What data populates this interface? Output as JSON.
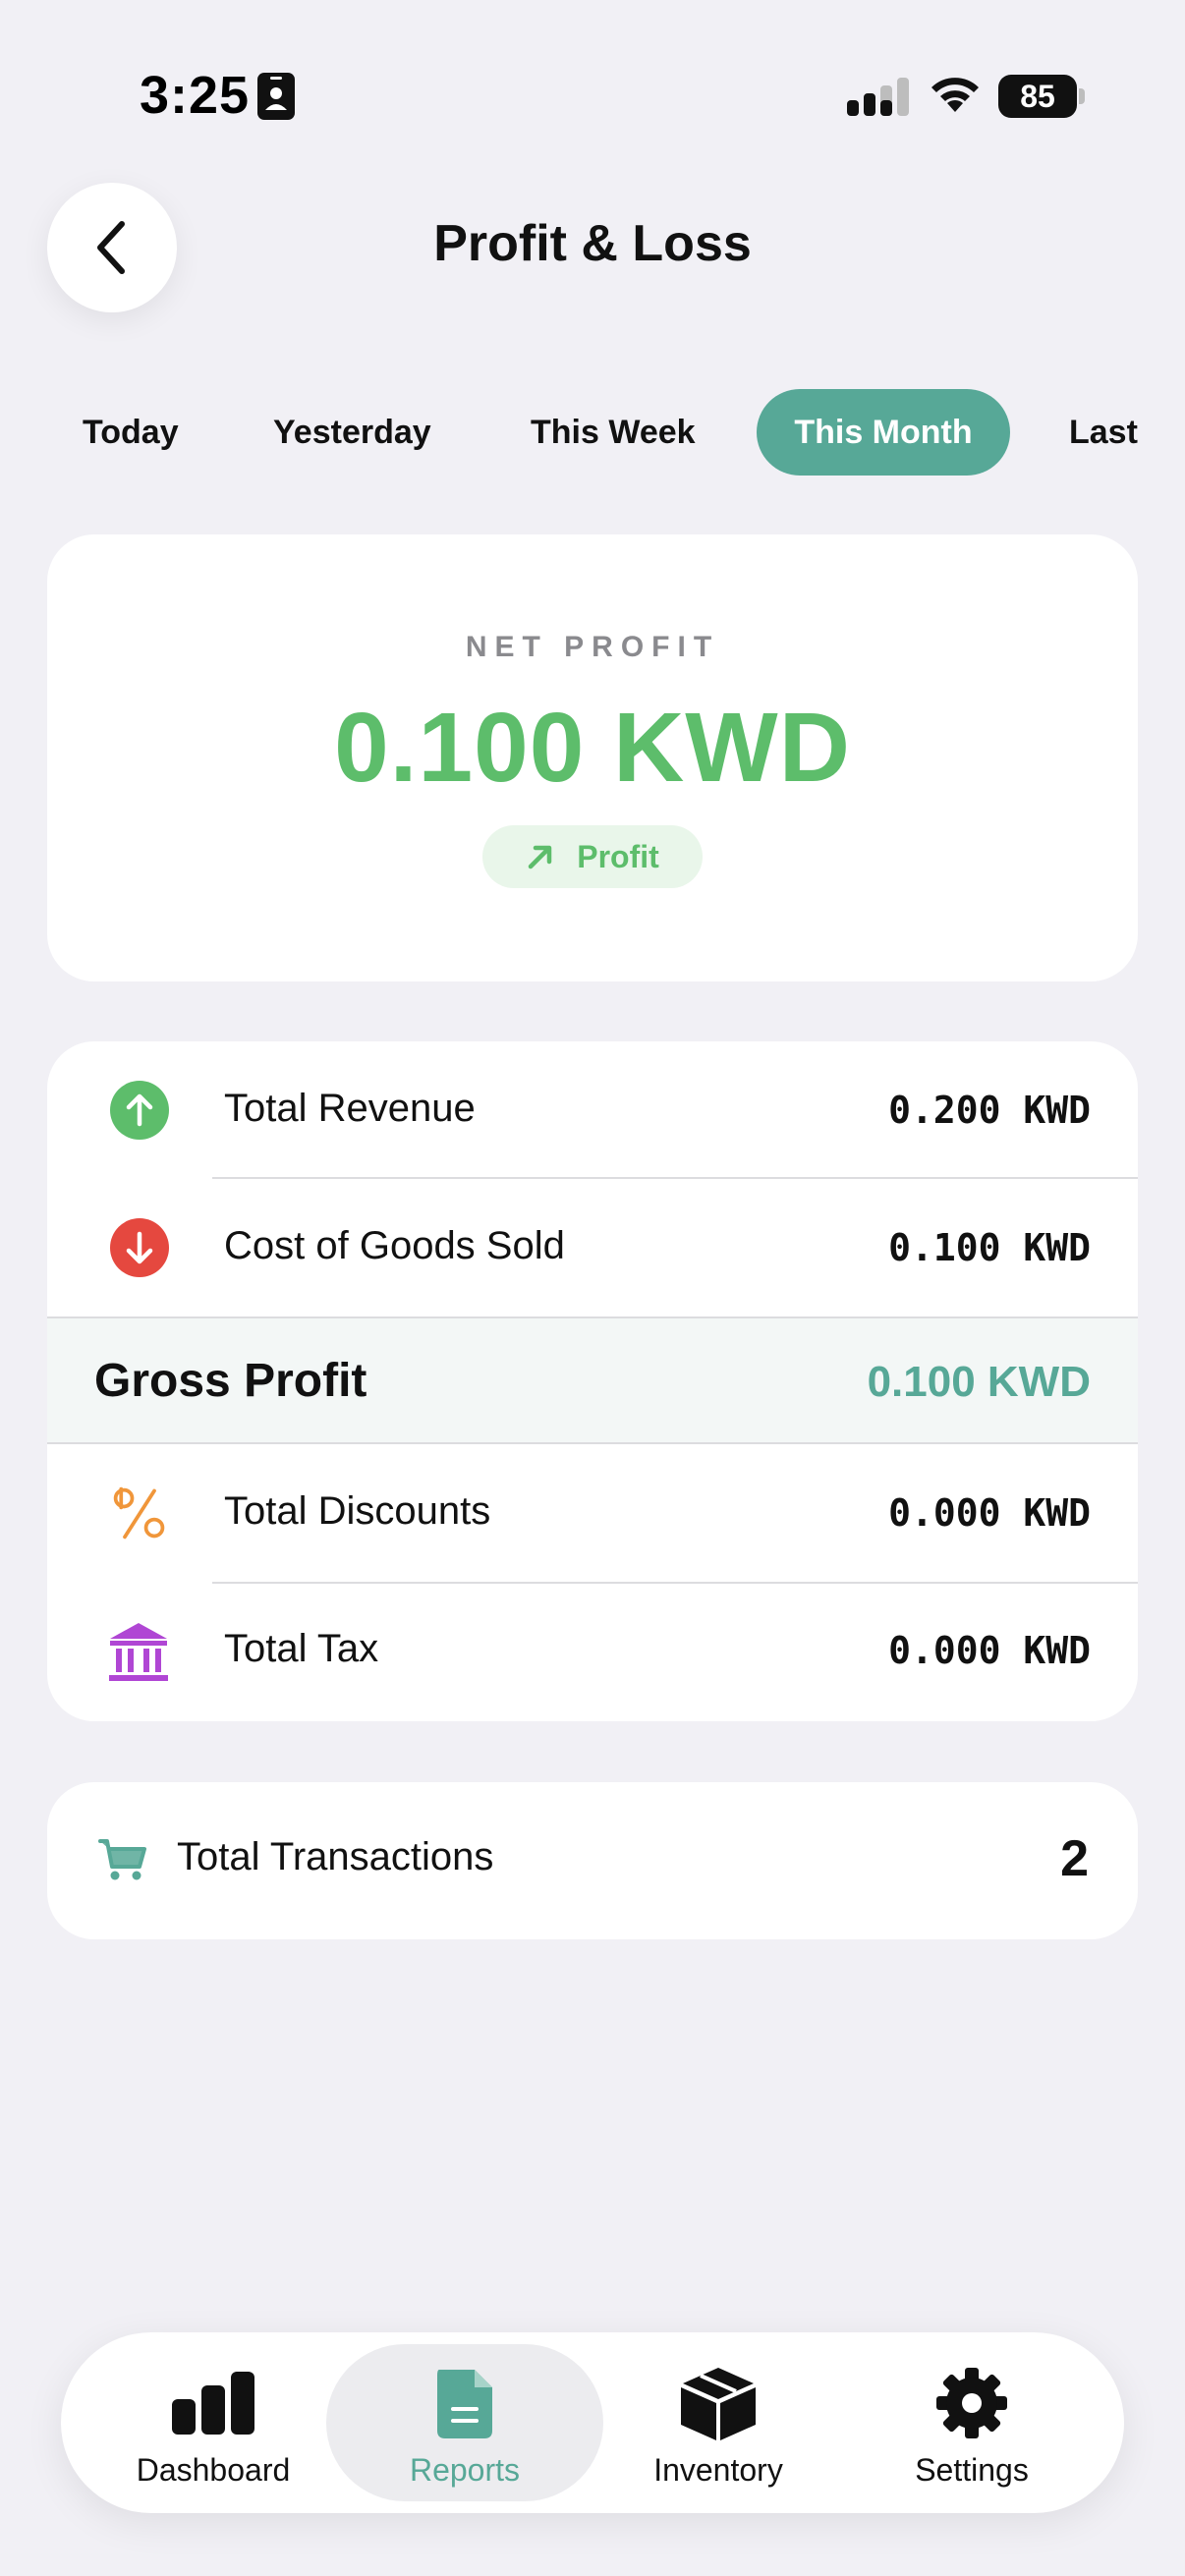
{
  "status_bar": {
    "time": "3:25",
    "battery": "85"
  },
  "header": {
    "title": "Profit & Loss"
  },
  "period_tabs": [
    {
      "label": "Today",
      "active": false
    },
    {
      "label": "Yesterday",
      "active": false
    },
    {
      "label": "This Week",
      "active": false
    },
    {
      "label": "This Month",
      "active": true
    },
    {
      "label": "Last",
      "active": false
    }
  ],
  "net_profit": {
    "label": "NET PROFIT",
    "value": "0.100 KWD",
    "badge": "Profit"
  },
  "breakdown": {
    "total_revenue": {
      "label": "Total Revenue",
      "value": "0.200 KWD",
      "icon": "arrow-up-circle-icon"
    },
    "cogs": {
      "label": "Cost of Goods Sold",
      "value": "0.100 KWD",
      "icon": "arrow-down-circle-icon"
    },
    "gross_profit": {
      "label": "Gross Profit",
      "value": "0.100 KWD"
    },
    "total_discounts": {
      "label": "Total Discounts",
      "value": "0.000 KWD",
      "icon": "percent-icon"
    },
    "total_tax": {
      "label": "Total Tax",
      "value": "0.000 KWD",
      "icon": "bank-icon"
    }
  },
  "transactions": {
    "label": "Total Transactions",
    "value": "2",
    "icon": "cart-icon"
  },
  "tab_bar": {
    "dashboard": "Dashboard",
    "reports": "Reports",
    "inventory": "Inventory",
    "settings": "Settings",
    "active": "reports"
  },
  "colors": {
    "accent": "#57a897",
    "profit_green": "#5dbd6b",
    "loss_red": "#e5483f",
    "discount_orange": "#f0963a",
    "tax_purple": "#b046d4",
    "background": "#f1f0f5"
  }
}
